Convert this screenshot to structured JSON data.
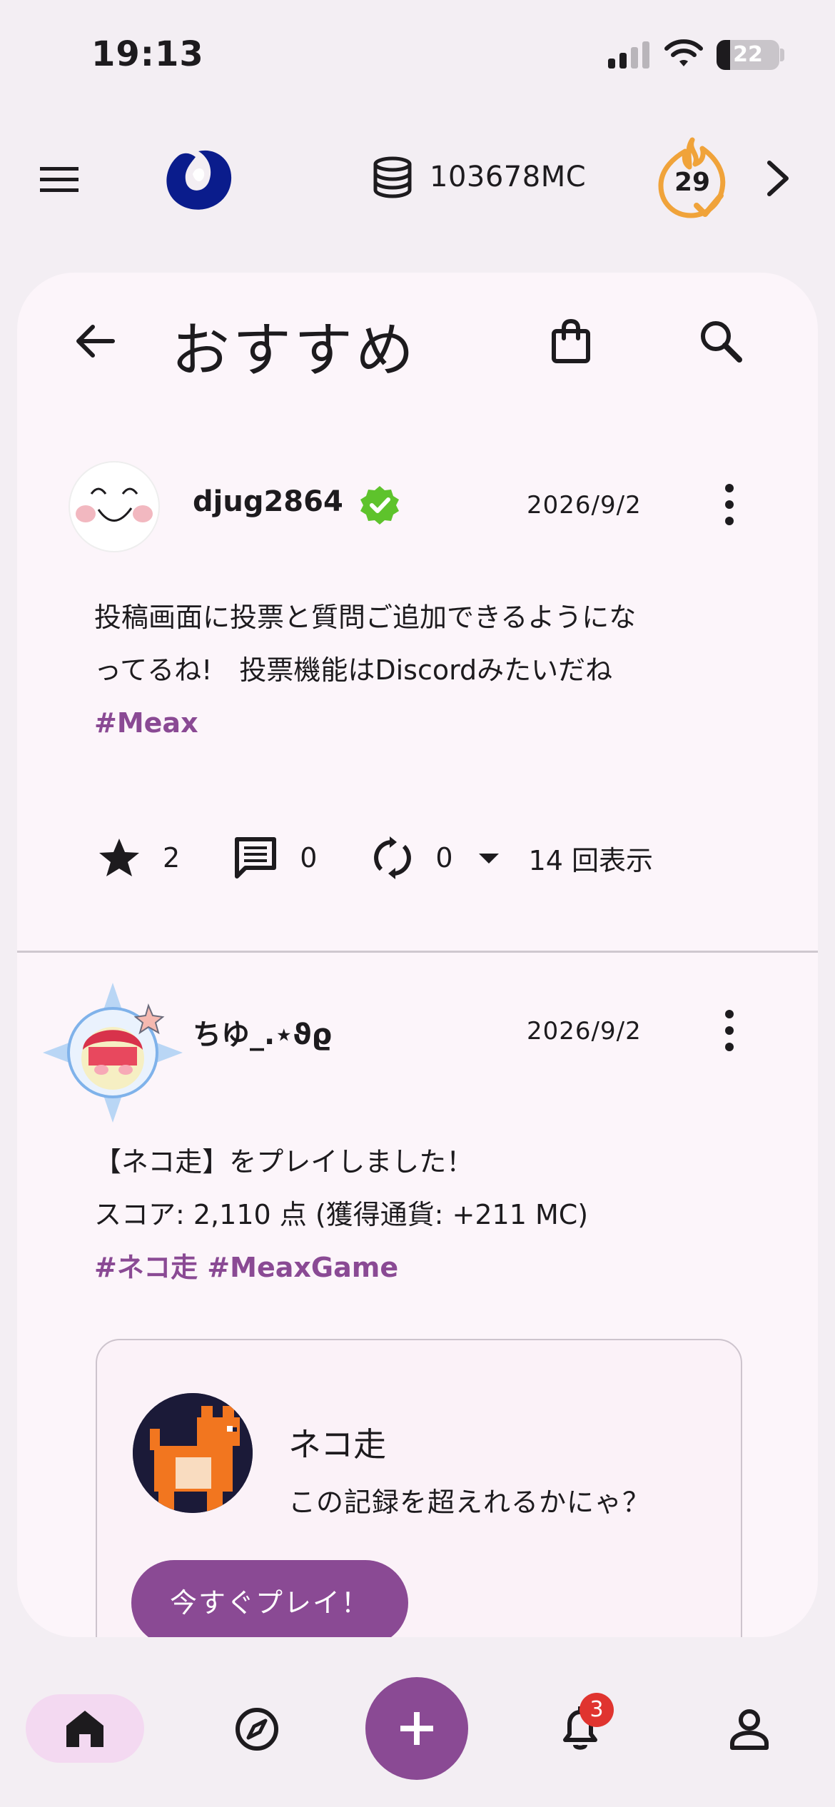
{
  "status_bar": {
    "time": "19:13",
    "battery": "22"
  },
  "top_bar": {
    "coins": "103678MC",
    "streak": "29"
  },
  "header": {
    "title": "おすすめ"
  },
  "posts": [
    {
      "username": "djug2864",
      "date": "2026/9/2",
      "text_lines": [
        "投稿画面に投票と質問ご追加できるようにな",
        "ってるね!　投票機能はDiscordみたいだね"
      ],
      "hashtags": "#Meax",
      "stars": "2",
      "comments": "0",
      "reposts": "0",
      "views": "14 回表示"
    },
    {
      "username": "ちゆ_.⋆ϑϱ",
      "date": "2026/9/2",
      "text_lines": [
        "【ネコ走】をプレイしました！",
        "スコア: 2,110 点 (獲得通貨: +211 MC)"
      ],
      "hashtags": "#ネコ走 #MeaxGame",
      "embed": {
        "title": "ネコ走",
        "subtitle": "この記録を超えれるかにゃ？",
        "button": "今すぐプレイ！"
      }
    }
  ],
  "bottom_nav": {
    "notification_count": "3"
  },
  "colors": {
    "accent": "#8a4a94",
    "verified": "#5ec32c",
    "streak": "#f0a33a",
    "logo": "#0a1c8c",
    "badge": "#e0342f"
  },
  "icons": [
    "menu-icon",
    "logo-icon",
    "coin-stack-icon",
    "streak-flame-icon",
    "chevron-right-icon",
    "back-arrow-icon",
    "shopping-bag-icon",
    "search-icon",
    "verified-badge-icon",
    "more-vert-icon",
    "star-icon",
    "comment-icon",
    "repost-icon",
    "dropdown-icon",
    "home-icon",
    "explore-icon",
    "add-icon",
    "bell-icon",
    "profile-icon"
  ]
}
